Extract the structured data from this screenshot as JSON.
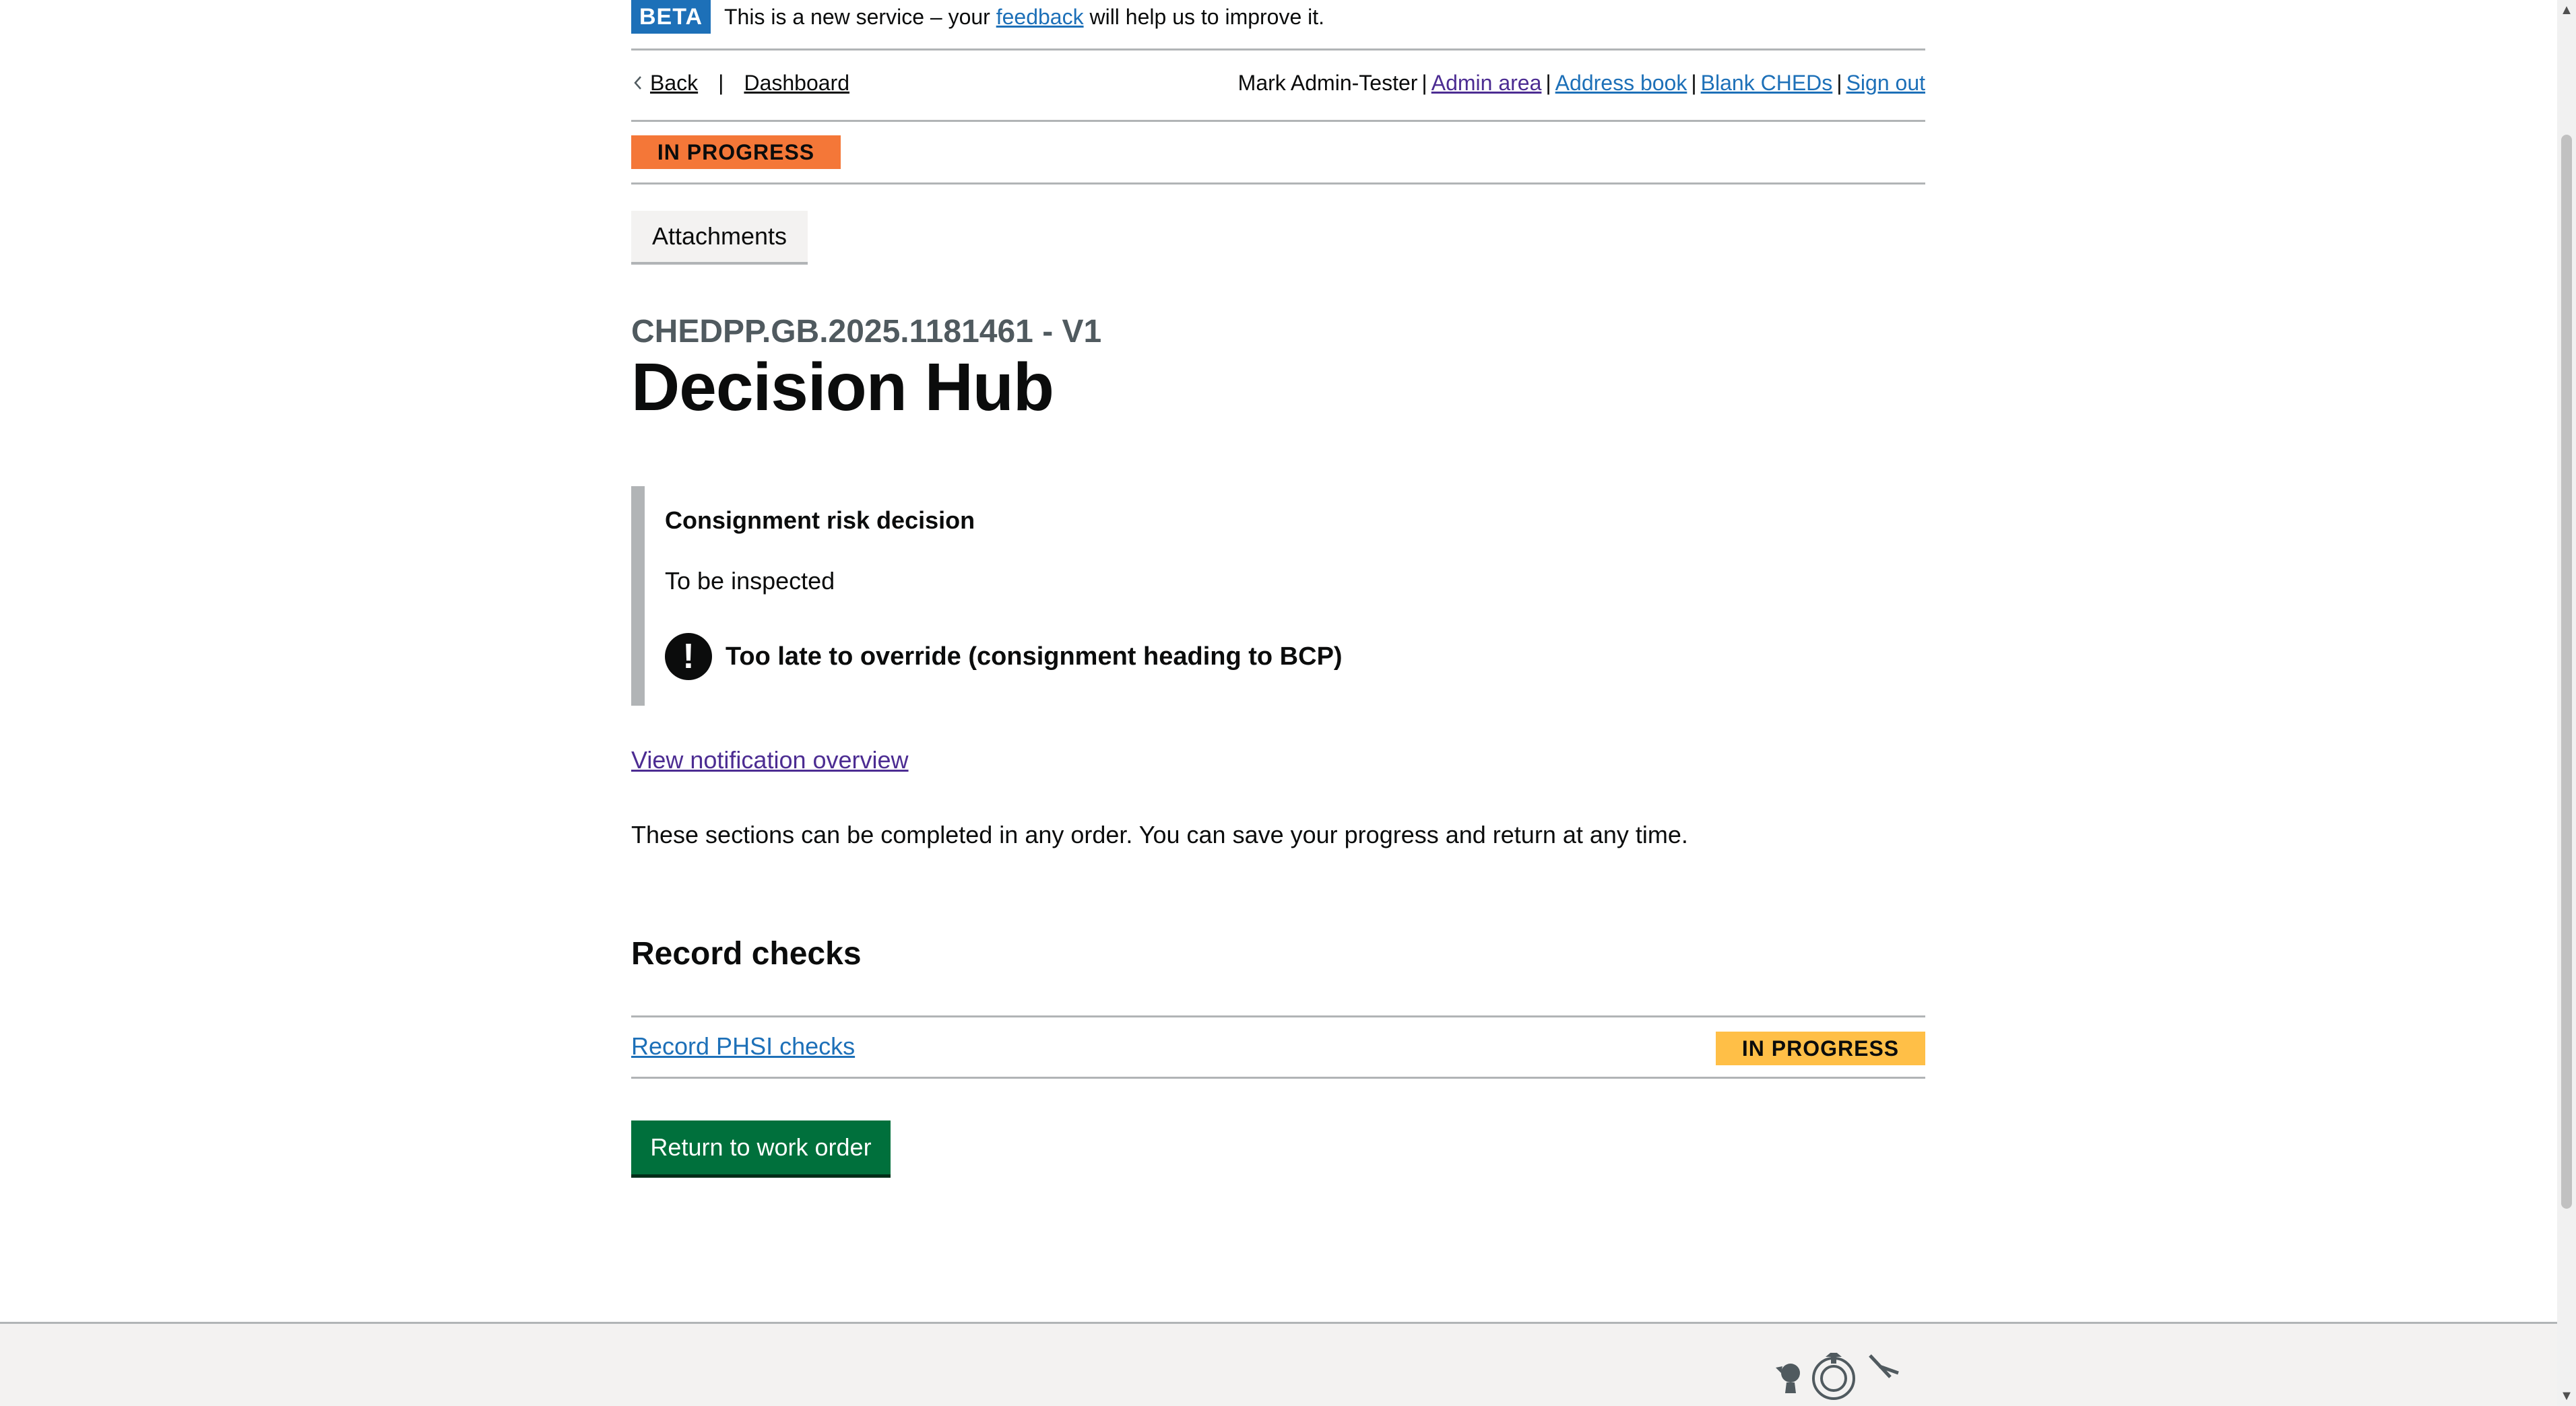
{
  "beta_banner": {
    "tag": "BETA",
    "text_before": "This is a new service – your ",
    "link": "feedback",
    "text_after": " will help us to improve it."
  },
  "nav": {
    "back": "Back",
    "separator": "|",
    "dashboard": "Dashboard",
    "user": "Mark Admin-Tester",
    "links": [
      "Admin area",
      "Address book",
      "Blank CHEDs",
      "Sign out"
    ]
  },
  "status": {
    "label": "IN PROGRESS",
    "color": "#f47738"
  },
  "tabs": {
    "attachments": "Attachments"
  },
  "header": {
    "caption": "CHEDPP.GB.2025.1181461 - V1",
    "title": "Decision Hub"
  },
  "risk_panel": {
    "title": "Consignment risk decision",
    "value": "To be inspected",
    "warning_icon": "!",
    "warning": "Too late to override (consignment heading to BCP)"
  },
  "overview_link": "View notification overview",
  "intro": "These sections can be completed in any order. You can save your progress and return at any time.",
  "record_checks": {
    "heading": "Record checks",
    "tasks": [
      {
        "label": "Record PHSI checks",
        "status": "IN PROGRESS",
        "status_color": "#ffbf47"
      }
    ]
  },
  "actions": {
    "return_button": "Return to work order"
  },
  "colors": {
    "link": "#1d70b8",
    "visited_link": "#4c2c92",
    "button": "#00703c",
    "beta": "#1d70b8"
  }
}
